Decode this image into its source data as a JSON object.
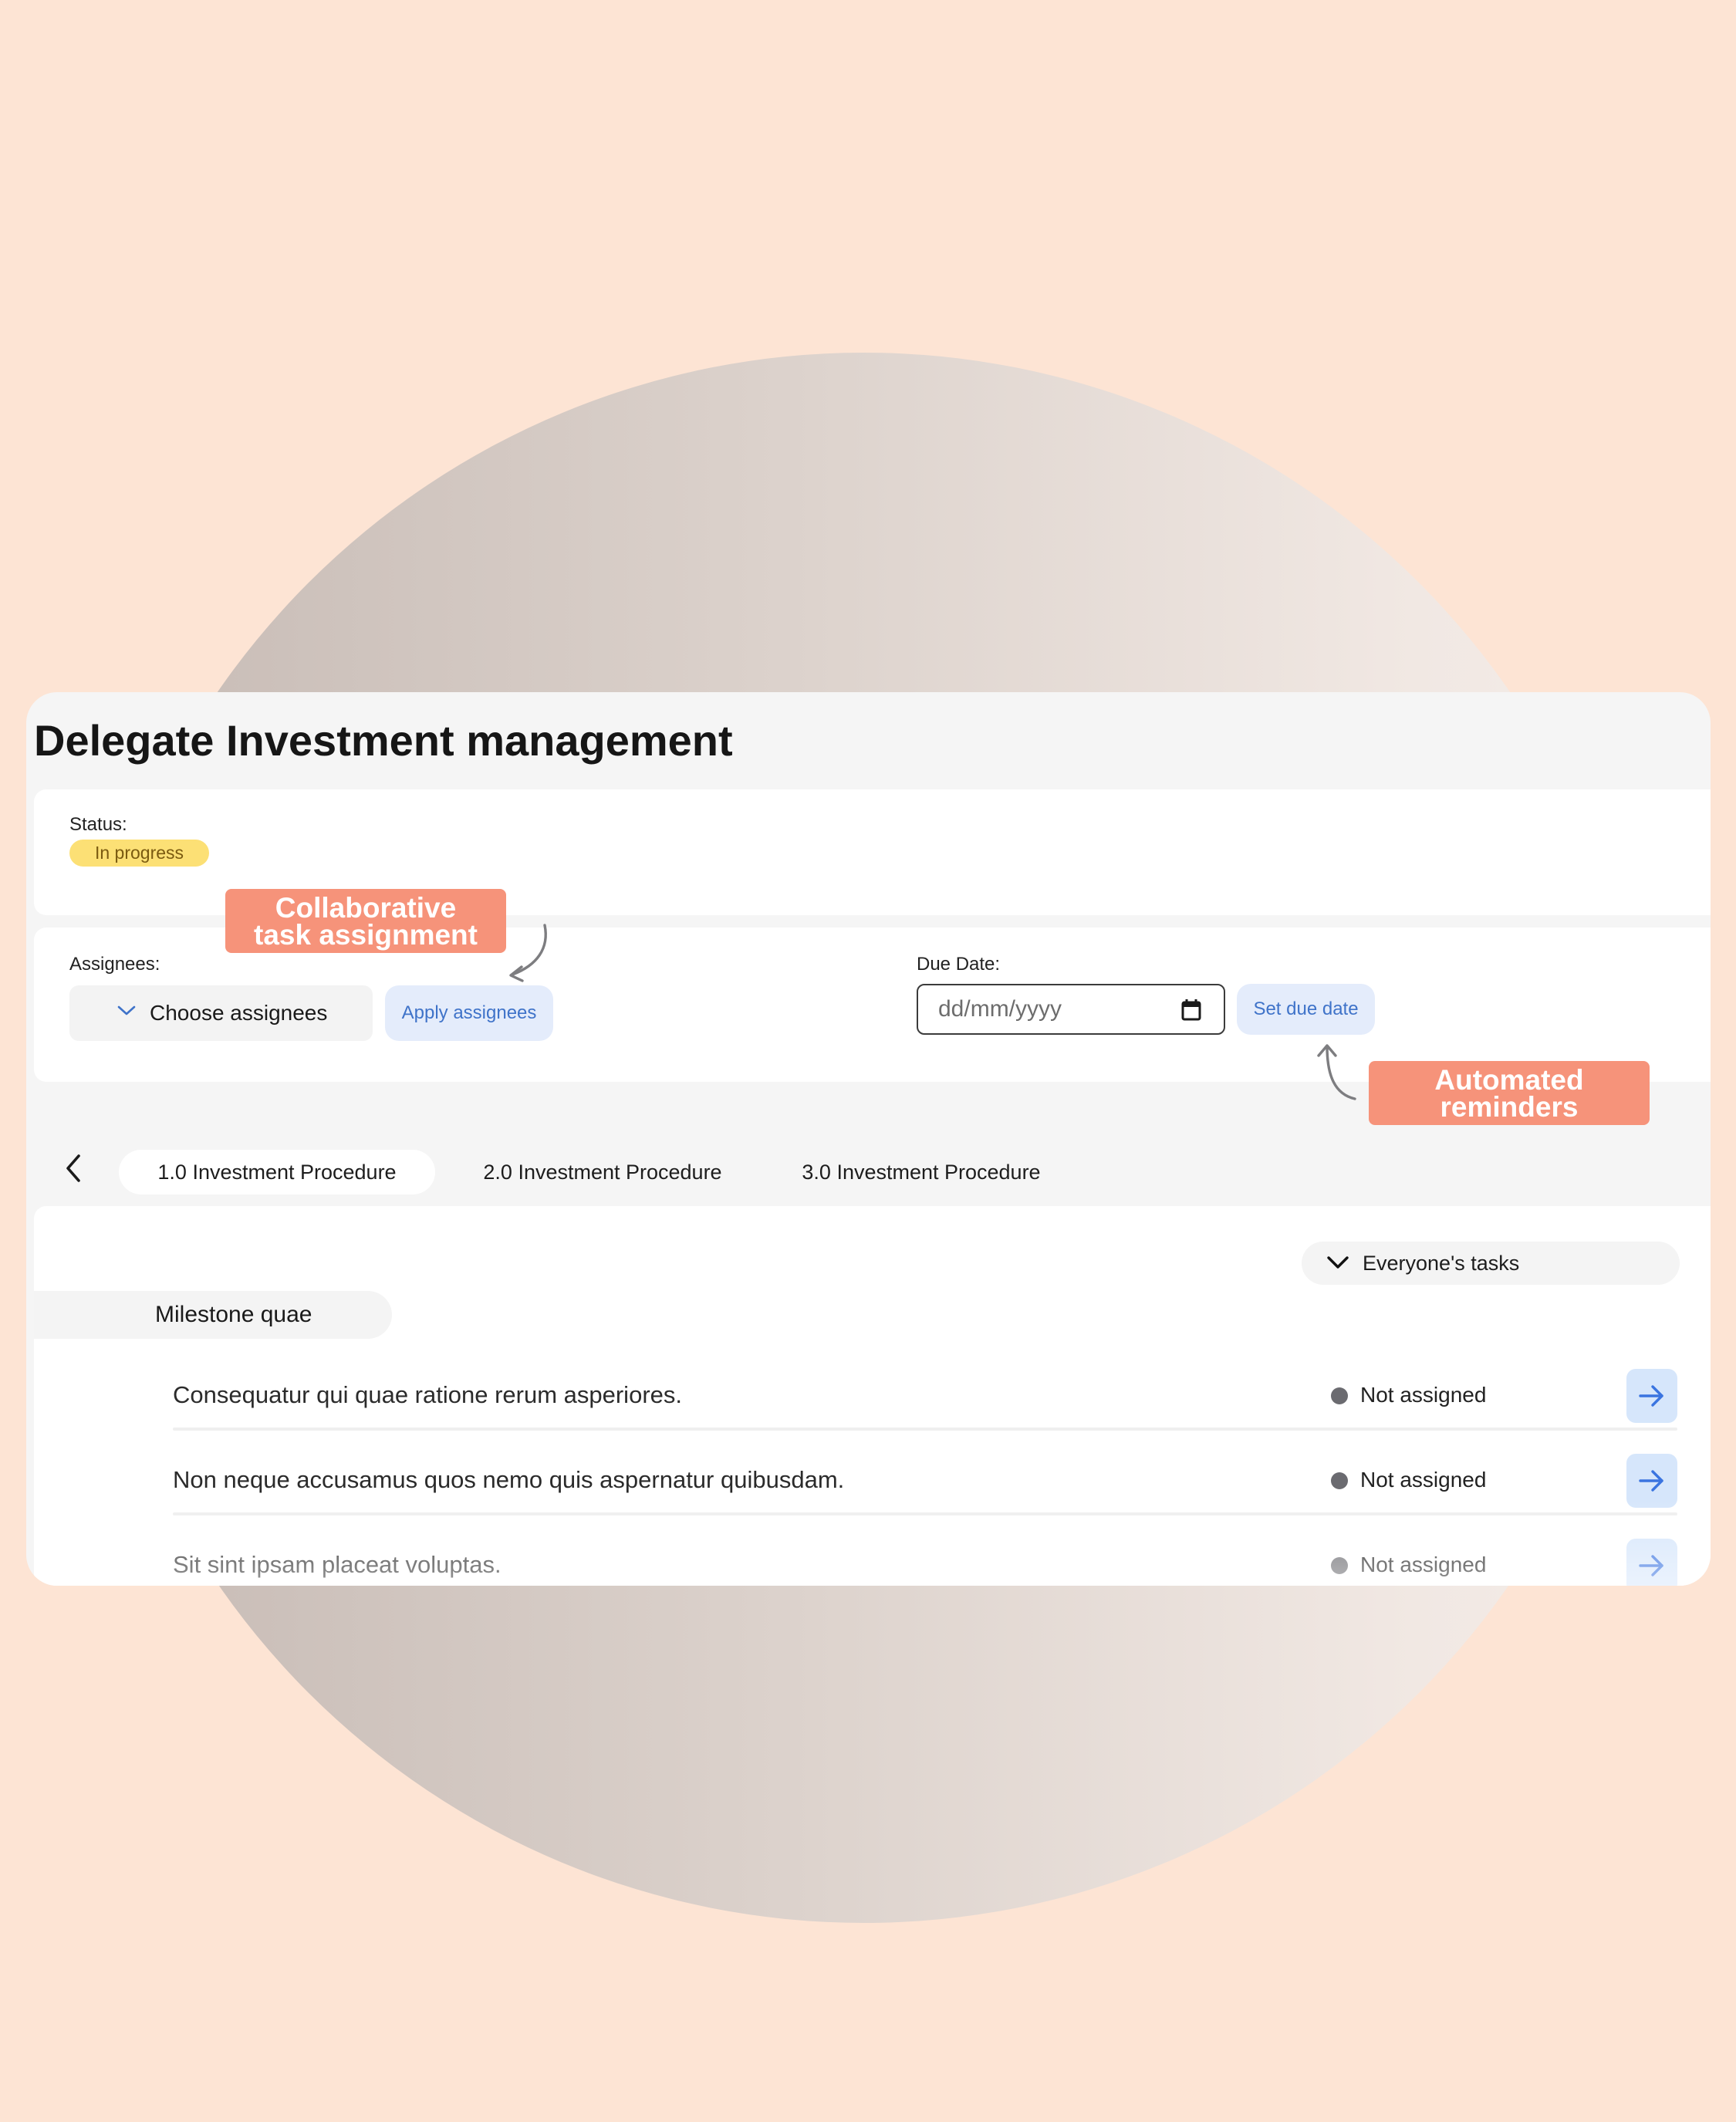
{
  "page": {
    "title": "Delegate Investment management"
  },
  "status": {
    "label": "Status:",
    "value": "In progress"
  },
  "assignees": {
    "label": "Assignees:",
    "select_label": "Choose assignees",
    "apply_label": "Apply assignees"
  },
  "due_date": {
    "label": "Due Date:",
    "placeholder": "dd/mm/yyyy",
    "set_label": "Set due date"
  },
  "tabs": [
    {
      "label": "1.0 Investment Procedure",
      "active": true
    },
    {
      "label": "2.0 Investment Procedure",
      "active": false
    },
    {
      "label": "3.0 Investment Procedure",
      "active": false
    }
  ],
  "filter": {
    "label": "Everyone's tasks"
  },
  "milestone": {
    "title": "Milestone quae"
  },
  "tasks": [
    {
      "title": "Consequatur qui quae ratione rerum asperiores.",
      "status": "Not assigned"
    },
    {
      "title": "Non neque accusamus quos nemo quis aspernatur quibusdam.",
      "status": "Not assigned"
    },
    {
      "title": "Sit sint ipsam placeat voluptas.",
      "status": "Not assigned"
    }
  ],
  "callouts": {
    "collaborative_line1": "Collaborative",
    "collaborative_line2": "task assignment",
    "reminders_line1": "Automated",
    "reminders_line2": "reminders"
  },
  "colors": {
    "background": "#fde4d4",
    "status_badge": "#fce075",
    "accent_blue": "#3f73c9",
    "callout": "#f6937a"
  },
  "icons": [
    "chevron-down-icon",
    "calendar-icon",
    "chevron-left-icon",
    "arrow-right-icon",
    "curved-arrow-icon"
  ]
}
